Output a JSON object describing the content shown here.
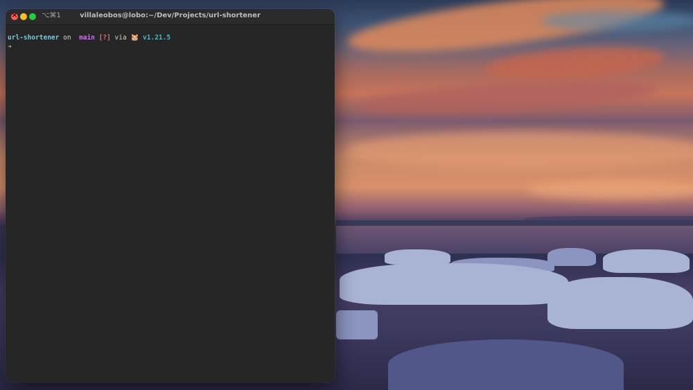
{
  "window": {
    "title": "villaleobos@lobo:~/Dev/Projects/url-shortener",
    "shortcut": "⌥⌘1"
  },
  "terminal": {
    "dir": "url-shortener",
    "on_word": "on",
    "branch_icon": "",
    "branch": "main",
    "git_status": "[?]",
    "via_word": "via",
    "runtime_icon": "🐹",
    "version": "v1.21.5",
    "prompt_symbol": "➜"
  },
  "colors": {
    "terminal_bg": "#262626",
    "dir": "#7fc7d9",
    "branch": "#c678dd",
    "status": "#e06c75",
    "version": "#56b6c2",
    "prompt": "#98c379"
  }
}
